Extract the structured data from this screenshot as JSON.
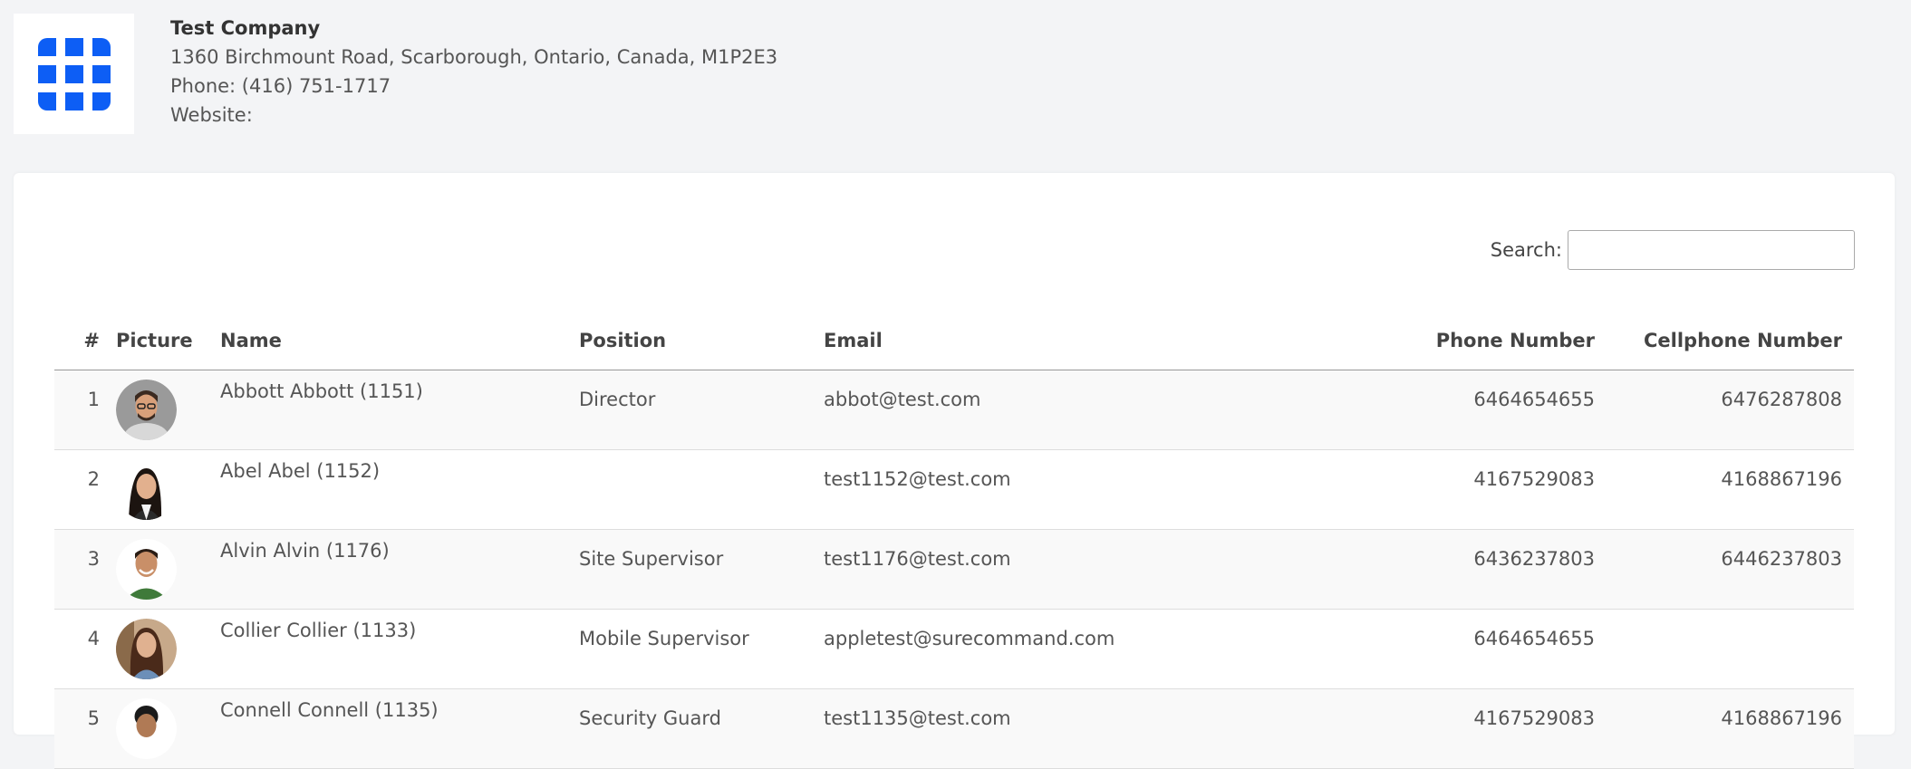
{
  "company": {
    "name": "Test Company",
    "address": "1360 Birchmount Road, Scarborough, Ontario, Canada, M1P2E3",
    "phone": "Phone: (416) 751-1717",
    "website": "Website:"
  },
  "search": {
    "label": "Search:",
    "value": ""
  },
  "table": {
    "headers": {
      "num": "#",
      "picture": "Picture",
      "name": "Name",
      "position": "Position",
      "email": "Email",
      "phone": "Phone Number",
      "cellphone": "Cellphone Number"
    },
    "rows": [
      {
        "num": "1",
        "name": "Abbott Abbott (1151)",
        "position": "Director",
        "email": "abbot@test.com",
        "phone": "6464654655",
        "cellphone": "6476287808"
      },
      {
        "num": "2",
        "name": "Abel Abel (1152)",
        "position": "",
        "email": "test1152@test.com",
        "phone": "4167529083",
        "cellphone": "4168867196"
      },
      {
        "num": "3",
        "name": "Alvin Alvin (1176)",
        "position": "Site Supervisor",
        "email": "test1176@test.com",
        "phone": "6436237803",
        "cellphone": "6446237803"
      },
      {
        "num": "4",
        "name": "Collier Collier (1133)",
        "position": "Mobile Supervisor",
        "email": "appletest@surecommand.com",
        "phone": "6464654655",
        "cellphone": ""
      },
      {
        "num": "5",
        "name": "Connell Connell (1135)",
        "position": "Security Guard",
        "email": "test1135@test.com",
        "phone": "4167529083",
        "cellphone": "4168867196"
      }
    ]
  },
  "colors": {
    "logo": "#0d5ef5",
    "page_bg": "#f3f4f6",
    "card_bg": "#ffffff"
  },
  "icons": {
    "logo": "grid-logo-icon"
  }
}
